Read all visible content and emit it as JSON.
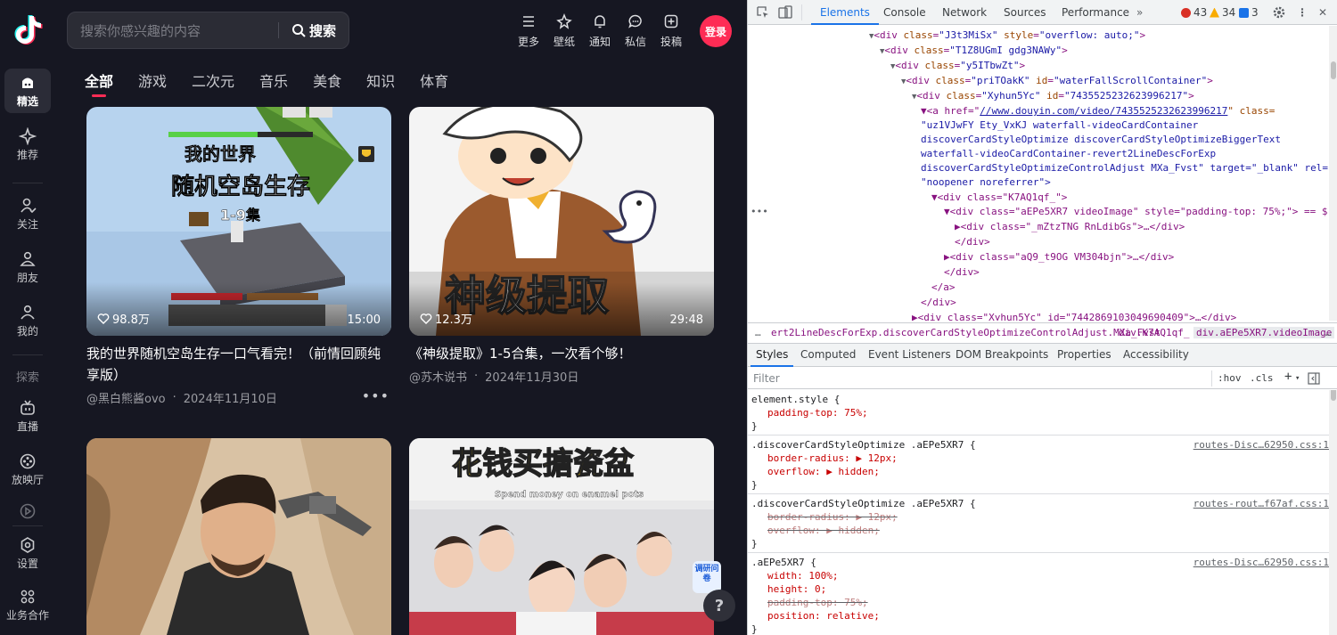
{
  "site": {
    "sidebar": {
      "items": [
        {
          "label": "精选",
          "icon": "home-icon",
          "active": true
        },
        {
          "label": "推荐",
          "icon": "sparkle-icon"
        },
        {
          "label": "关注",
          "icon": "follow-icon"
        },
        {
          "label": "朋友",
          "icon": "friends-icon"
        },
        {
          "label": "我的",
          "icon": "profile-icon"
        },
        {
          "label": "直播",
          "icon": "tv-icon"
        },
        {
          "label": "放映厅",
          "icon": "film-reel-icon"
        },
        {
          "label": "设置",
          "icon": "gear-icon"
        },
        {
          "label": "业务合作",
          "icon": "grid-icon"
        }
      ],
      "section_label": "探索"
    },
    "header": {
      "search_placeholder": "搜索你感兴趣的内容",
      "search_button": "搜索",
      "icons": [
        {
          "label": "更多",
          "icon": "menu-icon"
        },
        {
          "label": "壁纸",
          "icon": "wallpaper-icon"
        },
        {
          "label": "通知",
          "icon": "bell-icon"
        },
        {
          "label": "私信",
          "icon": "message-icon"
        },
        {
          "label": "投稿",
          "icon": "upload-icon"
        }
      ],
      "login": "登录"
    },
    "tabs": [
      "全部",
      "游戏",
      "二次元",
      "音乐",
      "美食",
      "知识",
      "体育"
    ],
    "cards": [
      {
        "thumb_text_1": "我的世界",
        "thumb_text_2": "随机空岛生存",
        "thumb_text_3": "1-9集",
        "likes": "98.8万",
        "duration": "15:00",
        "title": "我的世界随机空岛生存一口气看完！（前情回顾纯享版）",
        "author": "@黑白熊酱ovo",
        "date": "2024年11月10日",
        "more": "•••"
      },
      {
        "thumb_text_1": "神级提取",
        "likes": "12.3万",
        "duration": "29:48",
        "title": "《神级提取》1-5合集，一次看个够！",
        "author": "@苏木说书",
        "date": "2024年11月30日"
      },
      {
        "thumb_text_1": ""
      },
      {
        "thumb_text_1": "花钱买搪瓷盆",
        "thumb_text_2": "Spend money on enamel pots"
      }
    ],
    "survey_badge": "调研问卷",
    "help": "?"
  },
  "devtools": {
    "tabs": [
      "Elements",
      "Console",
      "Network",
      "Sources",
      "Performance"
    ],
    "errors": "43",
    "warnings": "34",
    "infos": "3",
    "dom_lines": [
      {
        "indent": 0,
        "tri": "▼",
        "tag": "div",
        "attrs": [
          [
            "class",
            "J3t3MiSx"
          ],
          [
            "style",
            "overflow: auto;"
          ]
        ],
        "close": ">"
      },
      {
        "indent": 1,
        "tri": "▼",
        "tag": "div",
        "attrs": [
          [
            "class",
            "T1Z8UGmI gdg3NAWy"
          ]
        ],
        "close": ">"
      },
      {
        "indent": 2,
        "tri": "▼",
        "tag": "div",
        "attrs": [
          [
            "class",
            "y5ITbwZt"
          ]
        ],
        "close": ">"
      },
      {
        "indent": 3,
        "tri": "▼",
        "tag": "div",
        "attrs": [
          [
            "class",
            "priTOakK"
          ],
          [
            "id",
            "waterFallScrollContainer"
          ]
        ],
        "close": ">"
      },
      {
        "indent": 4,
        "tri": "▼",
        "tag": "div",
        "attrs": [
          [
            "class",
            "Xyhun5Yc"
          ],
          [
            "id",
            "7435525232623996217"
          ]
        ],
        "close": ">"
      }
    ],
    "dom_raw": {
      "a_line_1": "▼<a href=\"",
      "a_href": "//www.douyin.com/video/7435525232623996217",
      "a_line_1_end": "\" class=",
      "a_line_2": "\"uz1VJwFY Ety_VxKJ waterfall-videoCardContainer",
      "a_line_3": "discoverCardStyleOptimize discoverCardStyleOptimizeBiggerText",
      "a_line_4": "waterfall-videoCardContainer-revert2LineDescForExp",
      "a_line_5": "discoverCardStyleOptimizeControlAdjust MXa_Fvst\" target=\"_blank\" rel=",
      "a_line_6": "\"noopener noreferrer\">",
      "l_k7": "▼<div class=\"K7AQ1qf_\">",
      "l_sel": "▼<div class=\"aEPe5XR7 videoImage\" style=\"padding-top: 75%;\"> == $",
      "l_mz": "▶<div class=\"_mZtzTNG RnLdibGs\">…</div>",
      "l_enddiv1": "</div>",
      "l_aq": "▶<div class=\"aQ9_t9OG VM304bjn\">…</div>",
      "l_enddiv2": "</div>",
      "l_enda": "</a>",
      "l_enddiv3": "</div>",
      "l_next": "▶<div class=\"Xyhun5Yc\" id=\"7442869103049690409\">…</div>",
      "dots": "•••"
    },
    "breadcrumbs": {
      "prefix": "…",
      "c1": "ert2LineDescForExp.discoverCardStyleOptimizeControlAdjust.MXa_Fvst",
      "c2": "div.K7AQ1qf_",
      "c3": "div.aEPe5XR7.videoImage",
      "suffix": "…"
    },
    "subtabs": [
      "Styles",
      "Computed",
      "Event Listeners",
      "DOM Breakpoints",
      "Properties",
      "Accessibility"
    ],
    "filter_placeholder": "Filter",
    "filter_hov": ":hov",
    "filter_cls": ".cls",
    "filter_plus": "+",
    "rules": {
      "r1_sel": "element.style {",
      "r1_p1": "padding-top: 75%;",
      "r2_sel": ".discoverCardStyleOptimize .aEPe5XR7 {",
      "r2_src": "routes-Disc…62950.css:1",
      "r2_p1": "border-radius: ▶ 12px;",
      "r2_p2": "overflow: ▶ hidden;",
      "r3_sel": ".discoverCardStyleOptimize .aEPe5XR7 {",
      "r3_src": "routes-rout…f67af.css:1",
      "r3_p1": "border-radius: ▶ 12px;",
      "r3_p2": "overflow: ▶ hidden;",
      "r4_sel": ".aEPe5XR7 {",
      "r4_src": "routes-Disc…62950.css:1",
      "r4_p1": "width: 100%;",
      "r4_p2": "height: 0;",
      "r4_p3": "padding-top: 75%;",
      "r4_p4": "position: relative;",
      "close": "}"
    }
  },
  "colors": {
    "accent": "#fe2c55",
    "site_bg": "#161722",
    "devtools_accent": "#1a73e8"
  }
}
